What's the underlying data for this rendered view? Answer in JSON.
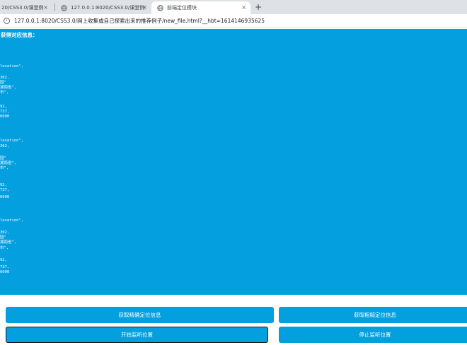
{
  "browser": {
    "tabs": [
      {
        "label": "20/CSS3.0/课堂例",
        "close": "×"
      },
      {
        "label": "127.0.0.1:8020/CSS3.0/课堂例",
        "close": "×"
      },
      {
        "label": "前端定位模块",
        "close": "×"
      }
    ],
    "new_tab": "+",
    "info_icon": "i",
    "url": "127.0.0.1:8020/CSS3.0/网上收集或自己探索出来的推荐例子/new_file.html?__hbt=1614146935625"
  },
  "page": {
    "heading": "获得对应信息：",
    "log_lines": [
      "location\",",
      "302,",
      "园\"",
      "湖南省\",",
      "市\",",
      "92,",
      "737,",
      "0000",
      "location\",",
      "302,",
      "园\"",
      "湖南省\",",
      "市\",",
      "92,",
      "737,",
      "0000",
      "location\",",
      "302,",
      "园\"",
      "湖南省\",",
      "市\",",
      "92,",
      "737,",
      "0000"
    ]
  },
  "buttons": {
    "precise": "获取精确定位信息",
    "rough": "获取粗糙定位信息",
    "start_watch": "开始监听位置",
    "stop_watch": "停止监听位置"
  },
  "colors": {
    "content_bg": "#039fdf",
    "button_bg": "#039fdf",
    "tabbar_bg": "#dee1e6"
  },
  "icons": {
    "tab_favicon": "globe-icon",
    "address_info": "info-icon",
    "tab_close": "close-icon"
  }
}
